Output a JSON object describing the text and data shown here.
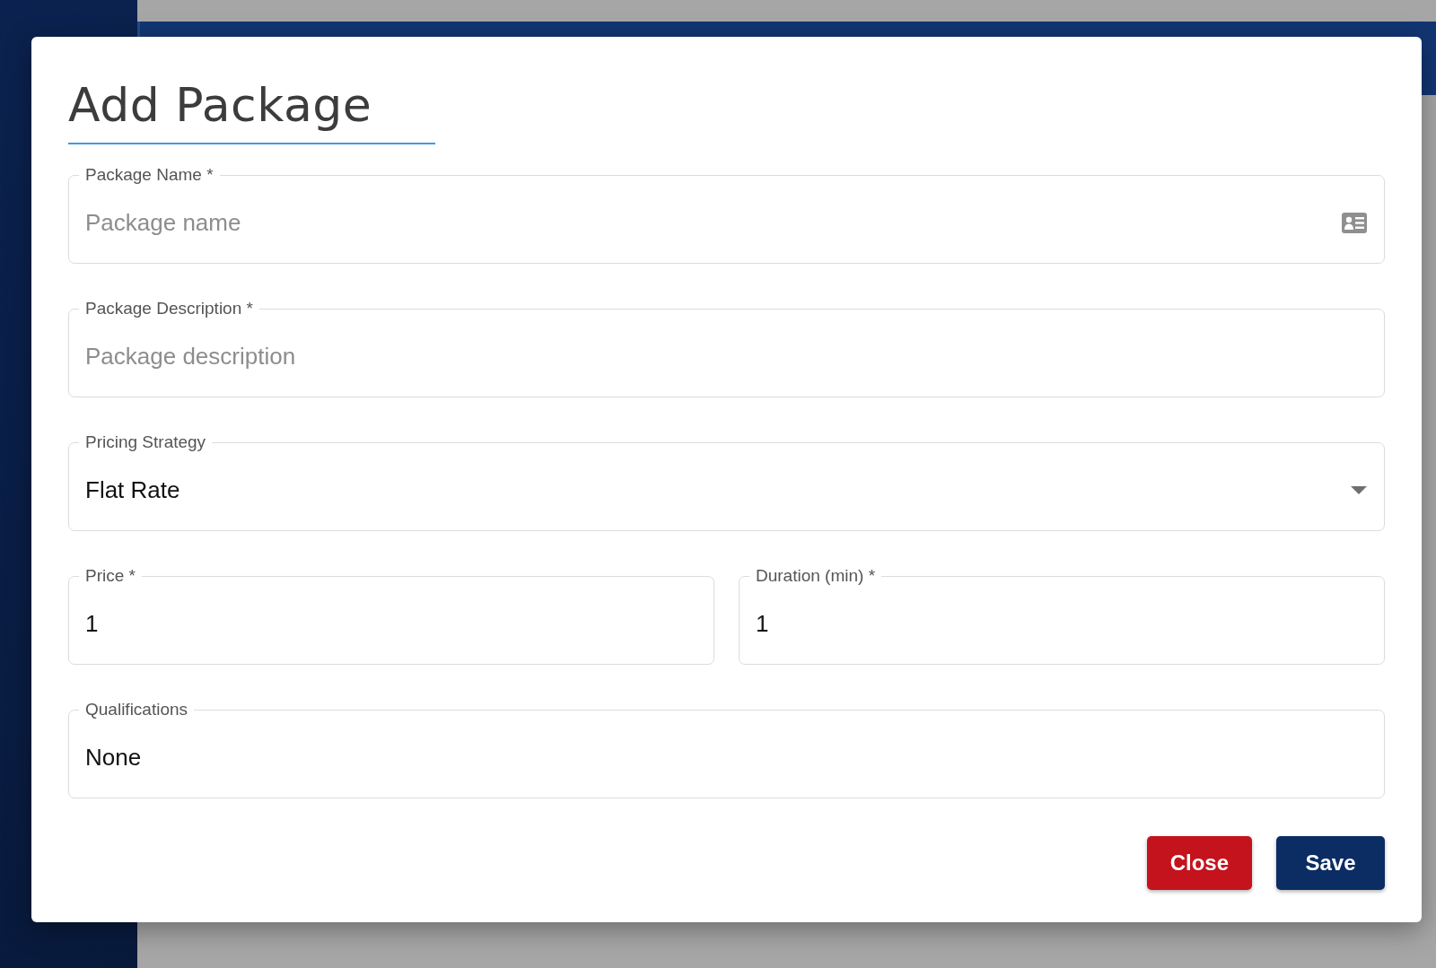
{
  "dialog": {
    "title": "Add Package",
    "rows": [
      [
        {
          "kind": "text",
          "label": "Package Name *",
          "placeholder": "Package name"
        }
      ],
      [
        {
          "kind": "text",
          "label": "Package Description *",
          "placeholder": "Package description"
        }
      ],
      [
        {
          "kind": "select",
          "label": "Pricing Strategy",
          "value": "Flat Rate"
        }
      ],
      [
        {
          "kind": "text",
          "label": "Price *",
          "value": "1"
        },
        {
          "kind": "text",
          "label": "Duration (min) *",
          "value": "1"
        }
      ],
      [
        {
          "kind": "text",
          "label": "Qualifications",
          "value": "None"
        }
      ]
    ],
    "buttons": [
      {
        "label": "Close"
      },
      {
        "label": "Save"
      }
    ]
  }
}
